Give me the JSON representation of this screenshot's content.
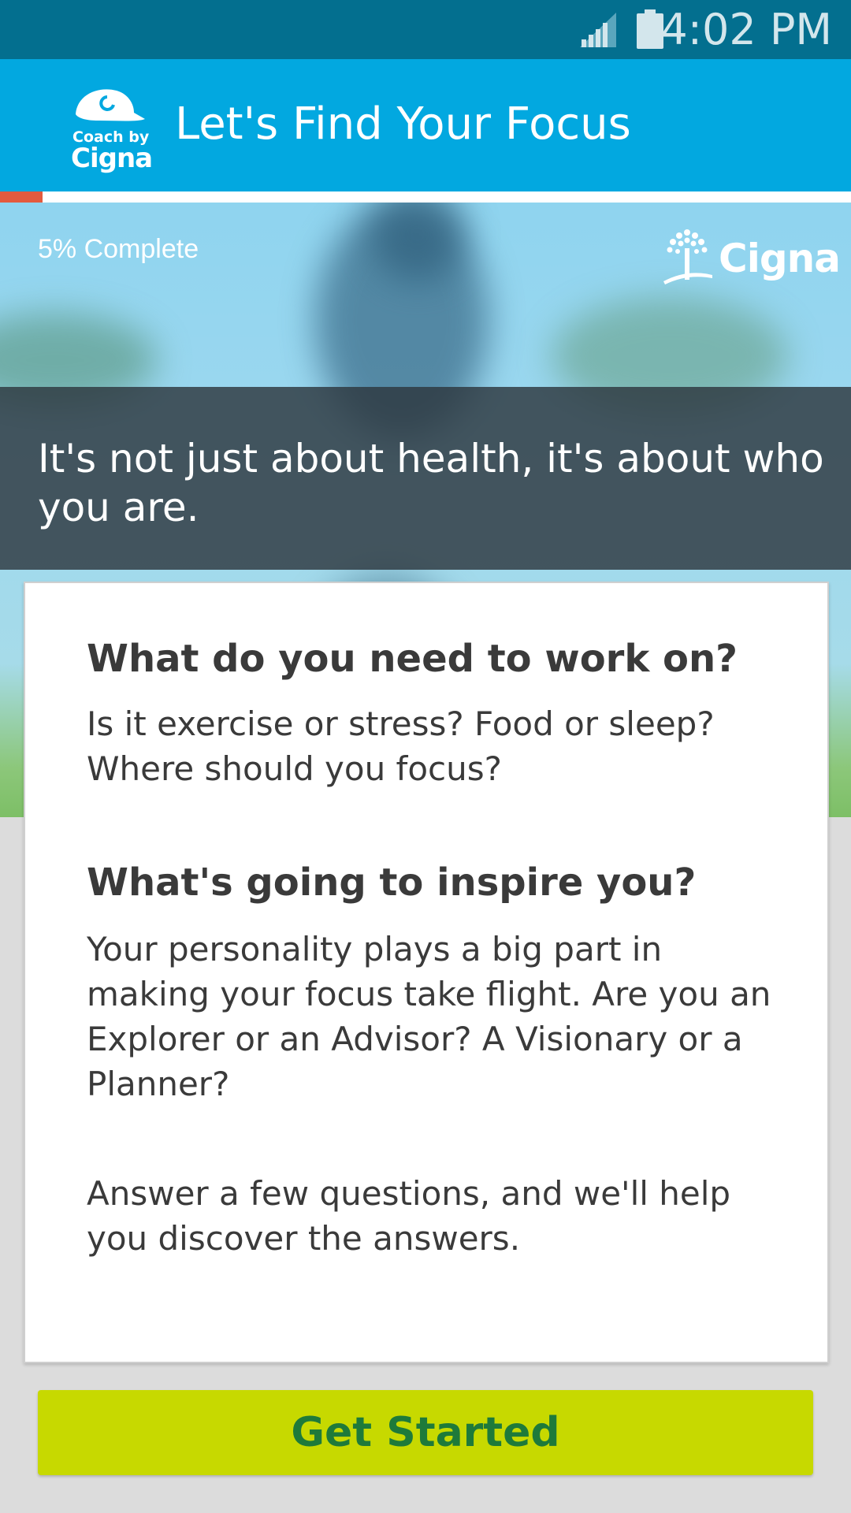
{
  "status_bar": {
    "time": "4:02 PM"
  },
  "app_bar": {
    "logo_small": "Coach by",
    "logo_big": "Cigna",
    "title": "Let's Find Your Focus"
  },
  "progress": {
    "percent_complete": 5,
    "label": "5% Complete"
  },
  "hero": {
    "brand": "Cigna",
    "banner_text": "It's not just about health, it's about who you are."
  },
  "card": {
    "heading_1": "What do you need to work on?",
    "body_1": "Is it exercise or stress? Food or sleep? Where should you focus?",
    "heading_2": "What's going to inspire you?",
    "body_2": "Your personality plays a big part in making your focus take flight. Are you an Explorer or an Advisor? A Visionary or a Planner?",
    "body_3": "Answer a few questions, and we'll help you discover the answers."
  },
  "cta": {
    "label": "Get Started"
  },
  "colors": {
    "status_bar": "#036f8f",
    "app_bar": "#02a8e0",
    "progress_fill": "#e35a3e",
    "cta_background": "#c7d900",
    "cta_text": "#1e7a3a"
  },
  "icons": [
    "signal-icon",
    "battery-icon",
    "coach-cap-logo-icon",
    "cigna-tree-logo-icon"
  ]
}
